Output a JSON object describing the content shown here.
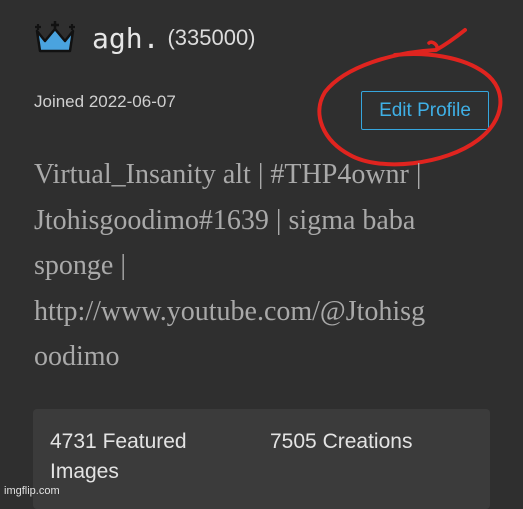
{
  "profile": {
    "username": "agh.",
    "points": "(335000)",
    "joined": "Joined 2022-06-07",
    "edit_button": "Edit Profile",
    "bio_lines": [
      "Virtual_Insanity alt | #THP4ownr |",
      "Jtohisgoodimo#1639 | sigma baba",
      "sponge |",
      "http://www.youtube.com/@Jtohisg",
      "oodimo"
    ],
    "crown_icon": "crown-icon",
    "crown_color": "#4aa3df"
  },
  "stats": {
    "featured": {
      "count": "4731",
      "label": "Featured Images"
    },
    "creations": {
      "count": "7505",
      "label": "Creations"
    }
  },
  "annotation": {
    "color": "#e0241f"
  },
  "watermark": "imgflip.com"
}
